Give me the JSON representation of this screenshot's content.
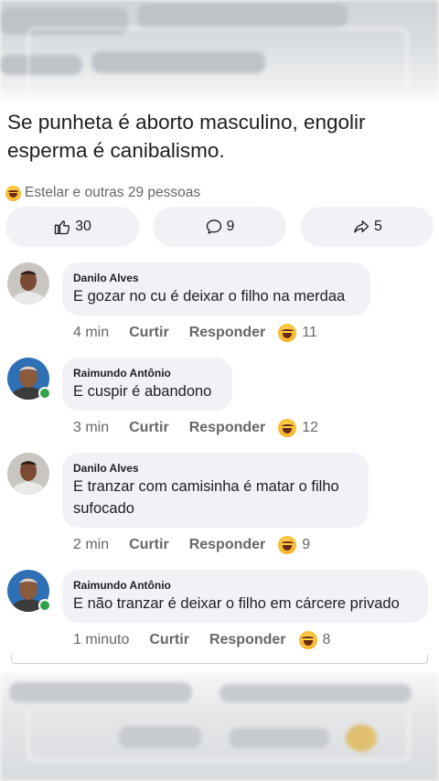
{
  "post": {
    "text": "Se punheta é aborto masculino, engolir esperma é canibalismo.",
    "reactions_summary": "Estelar e outras 29 pessoas"
  },
  "actions": {
    "like_count": "30",
    "comment_count": "9",
    "share_count": "5"
  },
  "comments": [
    {
      "author": "Danilo Alves",
      "text": "E gozar no cu é deixar o filho na merdaa",
      "time": "4 min",
      "like_label": "Curtir",
      "reply_label": "Responder",
      "reaction_count": "11",
      "online": false
    },
    {
      "author": "Raimundo Antônio",
      "text": "E cuspir é abandono",
      "time": "3 min",
      "like_label": "Curtir",
      "reply_label": "Responder",
      "reaction_count": "12",
      "online": true
    },
    {
      "author": "Danilo Alves",
      "text": "E tranzar com camisinha é matar o filho sufocado",
      "time": "2 min",
      "like_label": "Curtir",
      "reply_label": "Responder",
      "reaction_count": "9",
      "online": false
    },
    {
      "author": "Raimundo Antônio",
      "text": "E não tranzar é deixar o filho em cárcere privado",
      "time": "1 minuto",
      "like_label": "Curtir",
      "reply_label": "Responder",
      "reaction_count": "8",
      "online": true
    }
  ],
  "colors": {
    "bubble": "#f0f2f5",
    "secondary_text": "#65676b",
    "online": "#31a24c",
    "reaction": "#f7b125"
  },
  "icons": {
    "like": "thumbs-up-icon",
    "comment": "comment-bubble-icon",
    "share": "share-arrow-icon",
    "reaction": "laughing-emoji-icon"
  }
}
